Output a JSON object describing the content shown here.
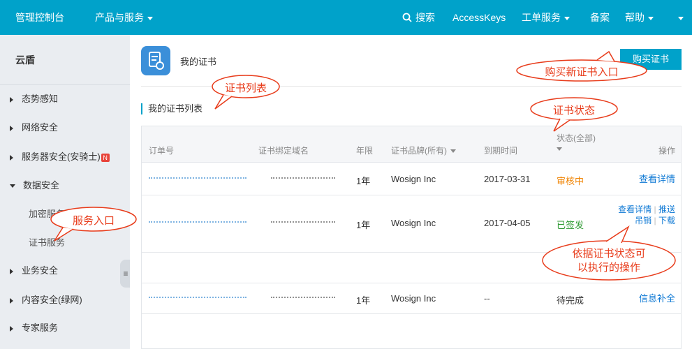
{
  "topbar": {
    "console": "管理控制台",
    "products": "产品与服务",
    "search": "搜索",
    "accesskeys": "AccessKeys",
    "ticket": "工单服务",
    "beian": "备案",
    "help": "帮助"
  },
  "sidebar": {
    "title": "云盾",
    "items": [
      {
        "label": "态势感知"
      },
      {
        "label": "网络安全"
      },
      {
        "label": "服务器安全(安骑士)",
        "badge": "N"
      },
      {
        "label": "数据安全"
      },
      {
        "label": "加密服务"
      },
      {
        "label": "证书服务"
      },
      {
        "label": "业务安全"
      },
      {
        "label": "内容安全(绿网)"
      },
      {
        "label": "专家服务"
      }
    ]
  },
  "page": {
    "title": "我的证书",
    "buy_button": "购买证书",
    "section_title": "我的证书列表"
  },
  "table": {
    "headers": {
      "order": "订单号",
      "domain": "证书绑定域名",
      "years": "年限",
      "brand": "证书品牌(所有)",
      "expire": "到期时间",
      "status": "状态(全部)",
      "ops": "操作"
    },
    "rows": [
      {
        "years": "1年",
        "brand": "Wosign Inc",
        "expire": "2017-03-31",
        "status": "审核中",
        "ops": [
          "查看详情"
        ]
      },
      {
        "years": "1年",
        "brand": "Wosign Inc",
        "expire": "2017-04-05",
        "status": "已签发",
        "ops": [
          "查看详情",
          "推送",
          "吊销",
          "下载"
        ]
      },
      {
        "years": "1年",
        "brand": "Wosign Inc",
        "expire": "--",
        "status": "待完成",
        "ops": [
          "信息补全"
        ]
      }
    ]
  },
  "annotations": {
    "buy_entry": "购买新证书入口",
    "cert_list": "证书列表",
    "cert_status": "证书状态",
    "service_entry": "服务入口",
    "ops_line1": "依据证书状态可",
    "ops_line2": "以执行的操作"
  },
  "colors": {
    "brand": "#00a2ca",
    "link": "#0d78d4",
    "reviewing": "#f08300",
    "issued": "#2f9a33",
    "annotation": "#e83b1a"
  }
}
